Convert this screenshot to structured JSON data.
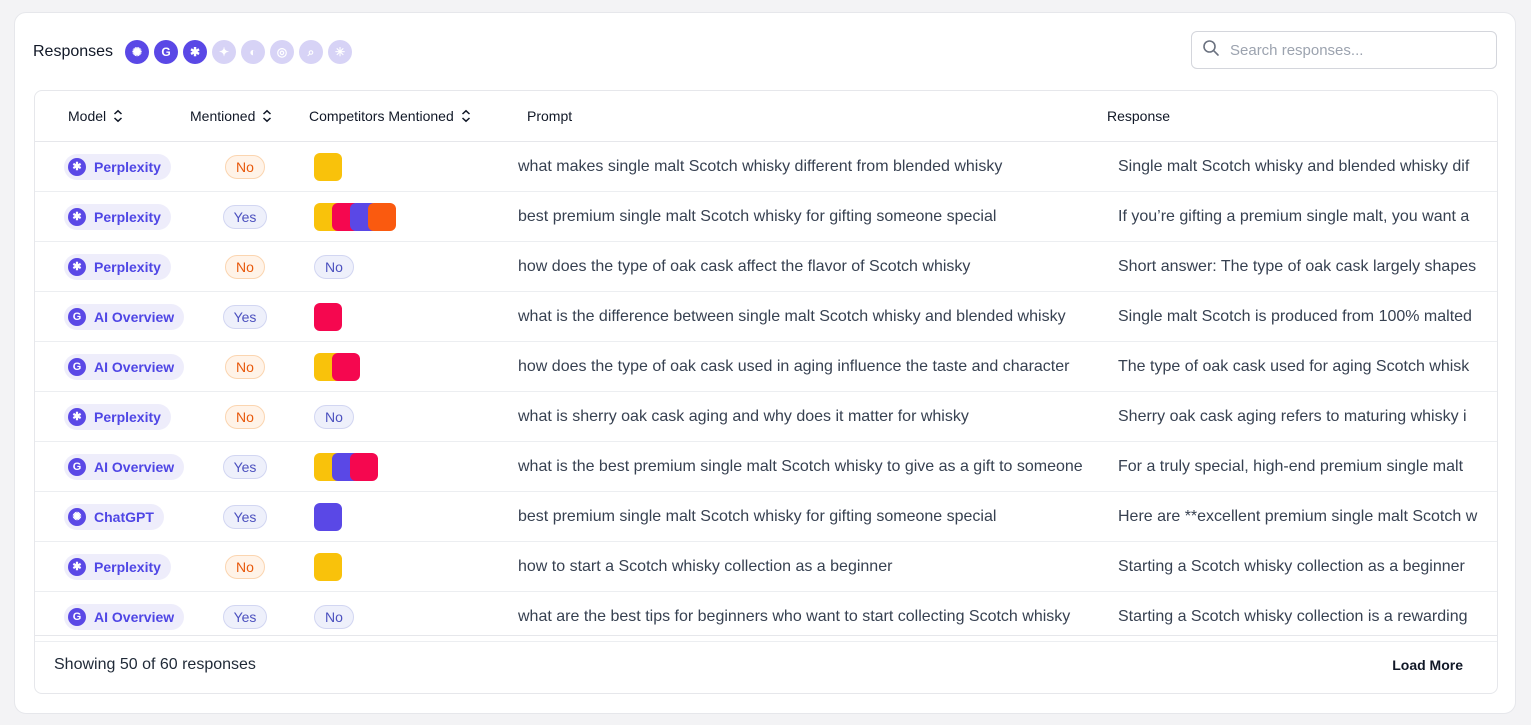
{
  "header": {
    "title": "Responses",
    "model_icons": [
      {
        "name": "chatgpt-icon",
        "glyph": "✺",
        "active": true
      },
      {
        "name": "google-icon",
        "glyph": "G",
        "active": true
      },
      {
        "name": "perplexity-icon",
        "glyph": "✱",
        "active": true
      },
      {
        "name": "gemini-icon",
        "glyph": "✦",
        "active": false
      },
      {
        "name": "compass-icon",
        "glyph": "◐",
        "active": false
      },
      {
        "name": "copilot-icon",
        "glyph": "◎",
        "active": false
      },
      {
        "name": "search-model-icon",
        "glyph": "⌕",
        "active": false
      },
      {
        "name": "claude-icon",
        "glyph": "✳",
        "active": false
      }
    ]
  },
  "search": {
    "placeholder": "Search responses..."
  },
  "table": {
    "columns": {
      "model": "Model",
      "mentioned": "Mentioned",
      "competitors": "Competitors Mentioned",
      "prompt": "Prompt",
      "response": "Response"
    },
    "no_competitor_label": "No",
    "rows": [
      {
        "model": "Perplexity",
        "model_icon": "perplexity",
        "mentioned": "No",
        "competitors": [
          "#f9c20b"
        ],
        "prompt": "what makes single malt Scotch whisky different from blended whisky",
        "response": "Single malt Scotch whisky and blended whisky dif"
      },
      {
        "model": "Perplexity",
        "model_icon": "perplexity",
        "mentioned": "Yes",
        "competitors": [
          "#f9c20b",
          "#f5074f",
          "#5a48e6",
          "#fa5a0f"
        ],
        "prompt": "best premium single malt Scotch whisky for gifting someone special",
        "response": "If you’re gifting a premium single malt, you want a"
      },
      {
        "model": "Perplexity",
        "model_icon": "perplexity",
        "mentioned": "No",
        "competitors": [],
        "prompt": "how does the type of oak cask affect the flavor of Scotch whisky",
        "response": "Short answer: The type of oak cask largely shapes"
      },
      {
        "model": "AI Overview",
        "model_icon": "google",
        "mentioned": "Yes",
        "competitors": [
          "#f5074f"
        ],
        "prompt": "what is the difference between single malt Scotch whisky and blended whisky",
        "response": "Single malt Scotch is produced from 100% malted"
      },
      {
        "model": "AI Overview",
        "model_icon": "google",
        "mentioned": "No",
        "competitors": [
          "#f9c20b",
          "#f5074f"
        ],
        "prompt": "how does the type of oak cask used in aging influence the taste and character",
        "response": "The type of oak cask used for aging Scotch whisk"
      },
      {
        "model": "Perplexity",
        "model_icon": "perplexity",
        "mentioned": "No",
        "competitors": [],
        "prompt": "what is sherry oak cask aging and why does it matter for whisky",
        "response": "Sherry oak cask aging refers to maturing whisky i"
      },
      {
        "model": "AI Overview",
        "model_icon": "google",
        "mentioned": "Yes",
        "competitors": [
          "#f9c20b",
          "#5a48e6",
          "#f5074f"
        ],
        "prompt": "what is the best premium single malt Scotch whisky to give as a gift to someone",
        "response": "For a truly special, high-end premium single malt"
      },
      {
        "model": "ChatGPT",
        "model_icon": "chatgpt",
        "mentioned": "Yes",
        "competitors": [
          "#5a48e6"
        ],
        "prompt": "best premium single malt Scotch whisky for gifting someone special",
        "response": "Here are **excellent premium single malt Scotch w"
      },
      {
        "model": "Perplexity",
        "model_icon": "perplexity",
        "mentioned": "No",
        "competitors": [
          "#f9c20b"
        ],
        "prompt": "how to start a Scotch whisky collection as a beginner",
        "response": "Starting a Scotch whisky collection as a beginner"
      },
      {
        "model": "AI Overview",
        "model_icon": "google",
        "mentioned": "Yes",
        "competitors": [],
        "prompt": "what are the best tips for beginners who want to start collecting Scotch whisky",
        "response": "Starting a Scotch whisky collection is a rewarding"
      }
    ]
  },
  "footer": {
    "count_text": "Showing 50 of 60 responses",
    "load_more": "Load More"
  }
}
